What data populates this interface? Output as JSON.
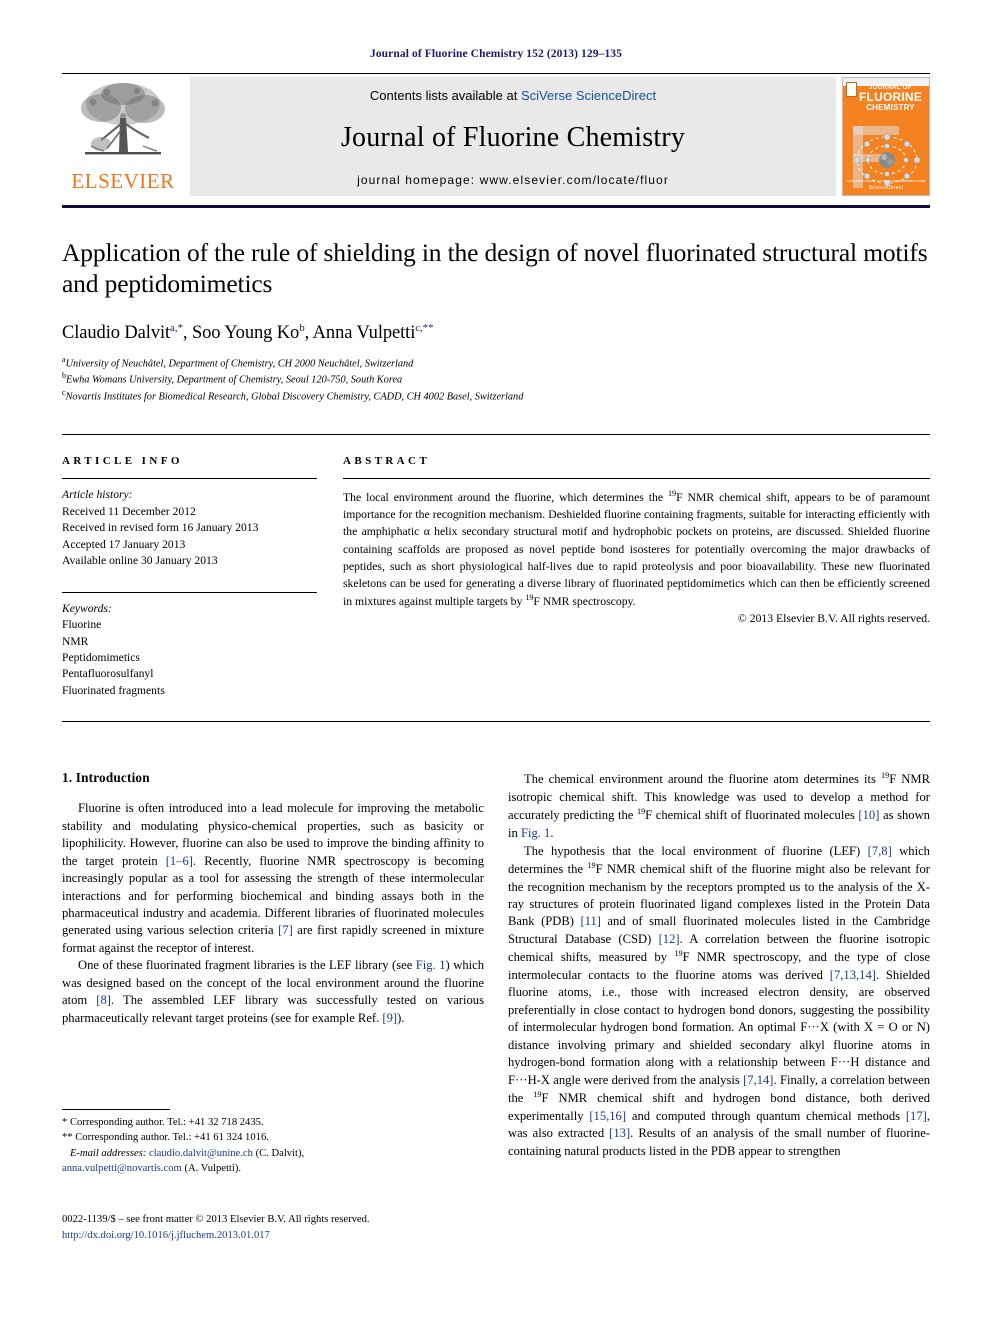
{
  "running_head": "Journal of Fluorine Chemistry 152 (2013) 129–135",
  "masthead": {
    "publisher_name": "ELSEVIER",
    "contents_prefix": "Contents lists available at ",
    "contents_link": "SciVerse ScienceDirect",
    "journal_title": "Journal of Fluorine Chemistry",
    "homepage": "journal homepage: www.elsevier.com/locate/fluor",
    "cover": {
      "line1": "JOURNAL OF",
      "line2": "FLUORINE",
      "line3": "CHEMISTRY",
      "footer1": "ᴀᴠᴀɪʟᴀʙʟᴇ ᴏɴʟɪɴᴇ ᴀᴛ ᴡᴡᴡ.sᴄɪᴇɴᴄᴇᴅɪʀᴇᴄᴛ.ᴄᴏᴍ",
      "footer2": "ScienceDirect"
    }
  },
  "article": {
    "title": "Application of the rule of shielding in the design of novel fluorinated structural motifs and peptidomimetics",
    "authors_html": "Claudio Dalvit<sup>a,*</sup>, Soo Young Ko<sup>b</sup>, Anna Vulpetti<sup>c,**</sup>",
    "affiliations": [
      "University of Neuchâtel, Department of Chemistry, CH 2000 Neuchâtel, Switzerland",
      "Ewha Womans University, Department of Chemistry, Seoul 120-750, South Korea",
      "Novartis Institutes for Biomedical Research, Global Discovery Chemistry, CADD, CH 4002 Basel, Switzerland"
    ],
    "affiliation_marks": [
      "a",
      "b",
      "c"
    ]
  },
  "article_info": {
    "label": "ARTICLE INFO",
    "history_heading": "Article history:",
    "history": [
      "Received 11 December 2012",
      "Received in revised form 16 January 2013",
      "Accepted 17 January 2013",
      "Available online 30 January 2013"
    ],
    "keywords_heading": "Keywords:",
    "keywords": [
      "Fluorine",
      "NMR",
      "Peptidomimetics",
      "Pentafluorosulfanyl",
      "Fluorinated fragments"
    ]
  },
  "abstract": {
    "label": "ABSTRACT",
    "text_html": "The local environment around the fluorine, which determines the <sup class=\"sup-num\">19</sup>F NMR chemical shift, appears to be of paramount importance for the recognition mechanism. Deshielded fluorine containing fragments, suitable for interacting efficiently with the amphiphatic &alpha; helix secondary structural motif and hydrophobic pockets on proteins, are discussed. Shielded fluorine containing scaffolds are proposed as novel peptide bond isosteres for potentially overcoming the major drawbacks of peptides, such as short physiological half-lives due to rapid proteolysis and poor bioavailability. These new fluorinated skeletons can be used for generating a diverse library of fluorinated peptidomimetics which can then be efficiently screened in mixtures against multiple targets by <sup class=\"sup-num\">19</sup>F NMR spectroscopy.",
    "copyright": "© 2013 Elsevier B.V. All rights reserved."
  },
  "body": {
    "section_heading": "1. Introduction",
    "left_paragraphs_html": [
      "Fluorine is often introduced into a lead molecule for improving the metabolic stability and modulating physico-chemical properties, such as basicity or lipophilicity. However, fluorine can also be used to improve the binding affinity to the target protein <span class=\"ref\">[1–6]</span>. Recently, fluorine NMR spectroscopy is becoming increasingly popular as a tool for assessing the strength of these intermolecular interactions and for performing biochemical and binding assays both in the pharmaceutical industry and academia. Different libraries of fluorinated molecules generated using various selection criteria <span class=\"ref\">[7]</span> are first rapidly screened in mixture format against the receptor of interest.",
      "One of these fluorinated fragment libraries is the LEF library (see <span class=\"figref\">Fig. 1</span>) which was designed based on the concept of the local environment around the fluorine atom <span class=\"ref\">[8]</span>. The assembled LEF library was successfully tested on various pharmaceutically relevant target proteins (see for example Ref. <span class=\"ref\">[9]</span>)."
    ],
    "right_paragraphs_html": [
      "The chemical environment around the fluorine atom determines its <sup class=\"sup-num\">19</sup>F NMR isotropic chemical shift. This knowledge was used to develop a method for accurately predicting the <sup class=\"sup-num\">19</sup>F chemical shift of fluorinated molecules <span class=\"ref\">[10]</span> as shown in <span class=\"figref\">Fig. 1</span>.",
      "The hypothesis that the local environment of fluorine (LEF) <span class=\"ref\">[7,8]</span> which determines the <sup class=\"sup-num\">19</sup>F NMR chemical shift of the fluorine might also be relevant for the recognition mechanism by the receptors prompted us to the analysis of the X-ray structures of protein fluorinated ligand complexes listed in the Protein Data Bank (PDB) <span class=\"ref\">[11]</span> and of small fluorinated molecules listed in the Cambridge Structural Database (CSD) <span class=\"ref\">[12]</span>. A correlation between the fluorine isotropic chemical shifts, measured by <sup class=\"sup-num\">19</sup>F NMR spectroscopy, and the type of close intermolecular contacts to the fluorine atoms was derived <span class=\"ref\">[7,13,14]</span>. Shielded fluorine atoms, i.e., those with increased electron density, are observed preferentially in close contact to hydrogen bond donors, suggesting the possibility of intermolecular hydrogen bond formation. An optimal F&middot;&middot;&middot;X (with X = O or N) distance involving primary and shielded secondary alkyl fluorine atoms in hydrogen-bond formation along with a relationship between F&middot;&middot;&middot;H distance and F&middot;&middot;&middot;H-X angle were derived from the analysis <span class=\"ref\">[7,14]</span>. Finally, a correlation between the <sup class=\"sup-num\">19</sup>F NMR chemical shift and hydrogen bond distance, both derived experimentally <span class=\"ref\">[15,16]</span> and computed through quantum chemical methods <span class=\"ref\">[17]</span>, was also extracted <span class=\"ref\">[13]</span>. Results of an analysis of the small number of fluorine-containing natural products listed in the PDB appear to strengthen"
    ]
  },
  "footnotes": {
    "corresponding1_html": "* Corresponding author. Tel.: +41 32 718 2435.",
    "corresponding2_html": "** Corresponding author. Tel.: +41 61 324 1016.",
    "email_label": "E-mail addresses:",
    "email1": "claudio.dalvit@unine.ch",
    "email1_owner": "(C. Dalvit),",
    "email2": "anna.vulpetti@novartis.com",
    "email2_owner": "(A. Vulpetti)."
  },
  "imprint": {
    "issn_line": "0022-1139/$ – see front matter © 2013 Elsevier B.V. All rights reserved.",
    "doi": "http://dx.doi.org/10.1016/j.jfluchem.2013.01.017"
  },
  "colors": {
    "running_head": "#1a1a6e",
    "link": "#1552a0",
    "reference": "#1a3a8f",
    "elsevier_orange": "#e87722",
    "cover_orange": "#f58220"
  }
}
